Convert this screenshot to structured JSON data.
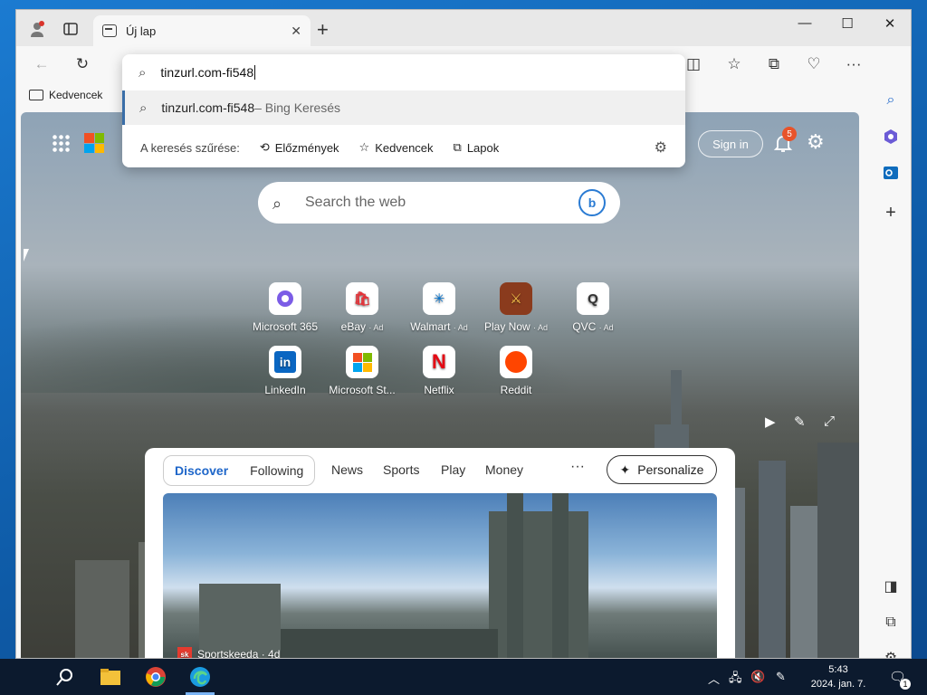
{
  "browser": {
    "tab_title": "Új lap",
    "address_text": "tinzurl.com-fi548",
    "favorites_label": "Kedvencek"
  },
  "dropdown": {
    "input_text": "tinzurl.com-fi548",
    "suggestion_main": "tinzurl.com-fi548",
    "suggestion_sub": " – Bing Keresés",
    "filter_label": "A keresés szűrése:",
    "filter_history": "Előzmények",
    "filter_favorites": "Kedvencek",
    "filter_tabs": "Lapok"
  },
  "newtab": {
    "sign_in": "Sign in",
    "notification_count": "5",
    "search_placeholder": "Search the web",
    "tiles": [
      {
        "label": "Microsoft 365",
        "ad": ""
      },
      {
        "label": "eBay",
        "ad": "· Ad"
      },
      {
        "label": "Walmart",
        "ad": "· Ad"
      },
      {
        "label": "Play Now",
        "ad": "· Ad"
      },
      {
        "label": "QVC",
        "ad": "· Ad"
      },
      {
        "label": "LinkedIn",
        "ad": ""
      },
      {
        "label": "Microsoft St...",
        "ad": ""
      },
      {
        "label": "Netflix",
        "ad": ""
      },
      {
        "label": "Reddit",
        "ad": ""
      }
    ]
  },
  "feed": {
    "tab_discover": "Discover",
    "tab_following": "Following",
    "nav_news": "News",
    "nav_sports": "Sports",
    "nav_play": "Play",
    "nav_money": "Money",
    "more": "···",
    "personalize": "Personalize",
    "card_source": "Sportskeeda · 4d"
  },
  "taskbar": {
    "time": "5:43",
    "date": "2024. jan. 7.",
    "notification_count": "1"
  }
}
